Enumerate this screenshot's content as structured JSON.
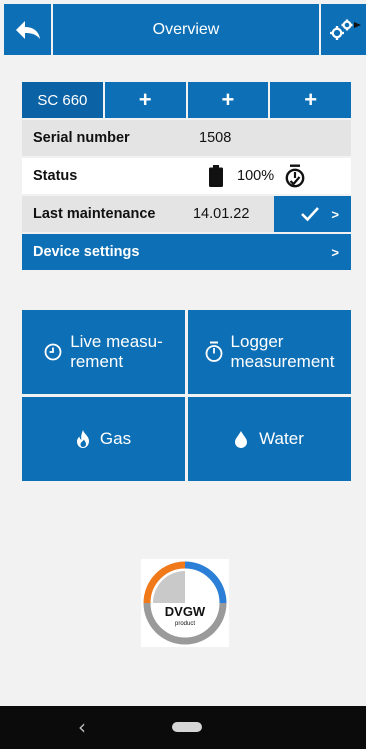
{
  "header": {
    "title": "Overview"
  },
  "tabs": [
    {
      "label": "SC 660"
    },
    {
      "label": "+"
    },
    {
      "label": "+"
    },
    {
      "label": "+"
    }
  ],
  "device": {
    "serial_label": "Serial number",
    "serial_value": "1508",
    "status_label": "Status",
    "battery_percent": "100%",
    "maintenance_label": "Last maintenance",
    "maintenance_date": "14.01.22",
    "maintenance_arrow": ">",
    "settings_label": "Device settings",
    "settings_arrow": ">"
  },
  "tiles": {
    "live": "Live measu-\nrement",
    "logger": "Logger\nmeasurement",
    "gas": "Gas",
    "water": "Water"
  },
  "logo": {
    "main": "DVGW",
    "sub": "product"
  },
  "navbar": {
    "back": "‹"
  },
  "colors": {
    "accent": "#0d6fb5",
    "panel": "#f2f2f2"
  }
}
